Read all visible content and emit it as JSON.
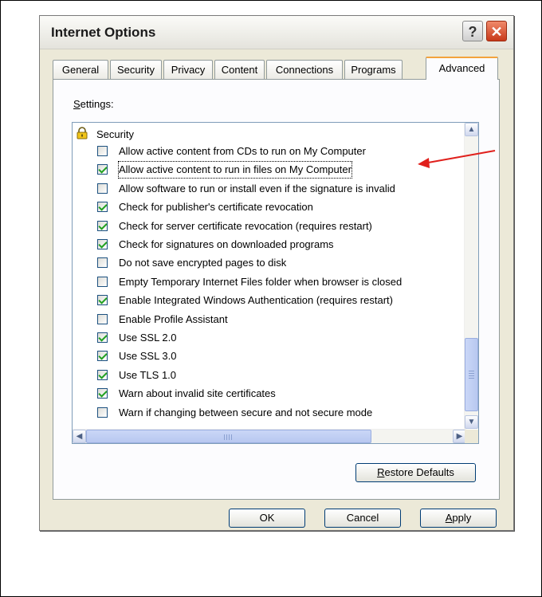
{
  "window": {
    "title": "Internet Options",
    "help_glyph": "?",
    "close_glyph": "✕"
  },
  "tabs": [
    {
      "label": "General",
      "active": false
    },
    {
      "label": "Security",
      "active": false
    },
    {
      "label": "Privacy",
      "active": false
    },
    {
      "label": "Content",
      "active": false
    },
    {
      "label": "Connections",
      "active": false
    },
    {
      "label": "Programs",
      "active": false
    },
    {
      "label": "Advanced",
      "active": true
    }
  ],
  "settings": {
    "label_prefix": "S",
    "label_rest": "ettings:",
    "category": {
      "label": "Security",
      "icon": "lock-icon"
    },
    "items": [
      {
        "label": "Allow active content from CDs to run on My Computer",
        "checked": false
      },
      {
        "label": "Allow active content to run in files on My Computer",
        "checked": true,
        "focused": true
      },
      {
        "label": "Allow software to run or install even if the signature is invalid",
        "checked": false
      },
      {
        "label": "Check for publisher's certificate revocation",
        "checked": true
      },
      {
        "label": "Check for server certificate revocation (requires restart)",
        "checked": true
      },
      {
        "label": "Check for signatures on downloaded programs",
        "checked": true
      },
      {
        "label": "Do not save encrypted pages to disk",
        "checked": false
      },
      {
        "label": "Empty Temporary Internet Files folder when browser is closed",
        "checked": false
      },
      {
        "label": "Enable Integrated Windows Authentication (requires restart)",
        "checked": true
      },
      {
        "label": "Enable Profile Assistant",
        "checked": false
      },
      {
        "label": "Use SSL 2.0",
        "checked": true
      },
      {
        "label": "Use SSL 3.0",
        "checked": true
      },
      {
        "label": "Use TLS 1.0",
        "checked": true
      },
      {
        "label": "Warn about invalid site certificates",
        "checked": true
      },
      {
        "label": "Warn if changing between secure and not secure mode",
        "checked": false
      }
    ]
  },
  "buttons": {
    "restore_key": "R",
    "restore_rest": "estore Defaults",
    "ok": "OK",
    "cancel": "Cancel",
    "apply_key": "A",
    "apply_rest": "pply"
  },
  "scrollbar_glyphs": {
    "up": "▲",
    "down": "▼",
    "left": "◀",
    "right": "▶"
  },
  "colors": {
    "annotation_arrow": "#e0201c",
    "active_tab_accent": "#f3a33c",
    "checkmark": "#21a121"
  }
}
